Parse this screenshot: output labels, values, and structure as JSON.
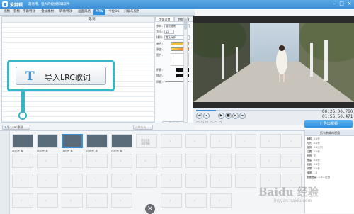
{
  "window": {
    "title": "爱剪辑",
    "subtitle": "最易用、强大的视频剪辑软件"
  },
  "tabs": [
    {
      "label": "视频"
    },
    {
      "label": "音频"
    },
    {
      "label": "字幕特效"
    },
    {
      "label": "叠加素材"
    },
    {
      "label": "转场特效"
    },
    {
      "label": "画面风格"
    },
    {
      "label": "MTV"
    },
    {
      "label": "卡拉OK"
    },
    {
      "label": "升级与服务"
    }
  ],
  "lyrics_panel": {
    "header": "歌词"
  },
  "callout": {
    "button_label": "导入LRC歌词",
    "icon_glyph": "T"
  },
  "footer": {
    "import_btn": "导入LRC歌词",
    "clear_btn": "清除所有",
    "apply_btn": "确认修改"
  },
  "side_panel": {
    "tabs": [
      "字体设置",
      "特效参数"
    ],
    "font_label": "字体:",
    "font_value": "微软雅黑",
    "size_label": "大小:",
    "size_value": "12",
    "align_label": "排列:",
    "align_value": "靠上对齐",
    "opt1": "单色:",
    "opt2": "渐变:",
    "opt3": "图片:",
    "shadow_label": "阴影:",
    "stroke_label": "描边:",
    "spacing_label": "间距:",
    "confirm_btn": "确认修改"
  },
  "player": {
    "time_current": "00:26:00.760",
    "time_total": "01:56:50.471"
  },
  "export_btn": "导出视频",
  "timeline": {
    "clips": [
      {
        "caption": "(1)时代_最"
      },
      {
        "caption": "(2)时代_最"
      },
      {
        "caption": "(3)时代_最"
      },
      {
        "caption": "(4)时代_最"
      },
      {
        "caption": "(5)时代_最"
      }
    ],
    "add_hint_1": "双击此处",
    "add_hint_2": "添加视频"
  },
  "props": {
    "header": "所有剪辑的视频",
    "rows": [
      {
        "k": "截取:",
        "v": "0:1秒"
      },
      {
        "k": "时长:",
        "v": "0:1秒"
      },
      {
        "k": "裁剪:",
        "v": "0:1比例"
      },
      {
        "k": "位置:",
        "v": "0:1秒"
      },
      {
        "k": "声音:",
        "v": "无"
      },
      {
        "k": "音量:",
        "v": "0:1秒"
      },
      {
        "k": "画面:",
        "v": "0:1秒"
      },
      {
        "k": "效果:",
        "v": "0:1秒"
      },
      {
        "k": "速度:",
        "v": "1.0"
      },
      {
        "k": "画面宽高:",
        "v": "1.6:1比例"
      }
    ]
  },
  "colors": {
    "accent": "#3b8fd6",
    "callout": "#33b8c8"
  },
  "watermark": {
    "big": "Baidu 经验",
    "small": "jingyan.baidu.com"
  }
}
